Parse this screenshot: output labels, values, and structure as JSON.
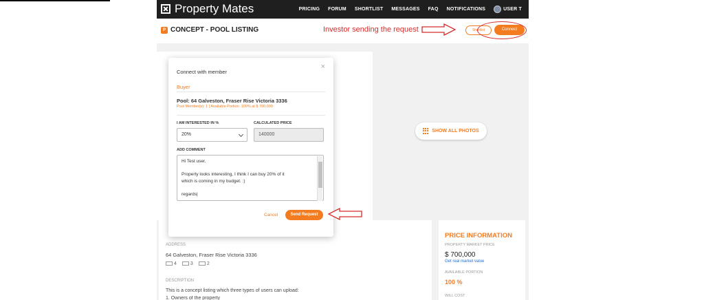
{
  "nav": {
    "brand": "Property Mates",
    "items": [
      "PRICING",
      "FORUM",
      "SHORTLIST",
      "MESSAGES",
      "FAQ",
      "NOTIFICATIONS"
    ],
    "user": "USER T"
  },
  "titlebar": {
    "badge": "P",
    "title": "CONCEPT - POOL LISTING",
    "annotation": "Investor sending the request",
    "shortlist_label": "Shortlist",
    "connect_label": "Connect"
  },
  "photos": {
    "show_all": "SHOW ALL PHOTOS"
  },
  "details": {
    "address_label": "ADDRESS",
    "address": "64 Galveston, Fraser Rise Victoria 3336",
    "beds": "4",
    "baths": "3",
    "cars": "2",
    "description_label": "DESCRIPTION",
    "description": "This is a concept listing which three types of users can upload:",
    "description_next": "1. Owners of the property"
  },
  "price_info": {
    "title": "PRICE INFORMATION",
    "market_price_label": "PROPERTY MARKET PRICE",
    "market_price": "$ 700,000",
    "real_value_link": "Get real market value",
    "available_portion_label": "AVAILABLE PORTION",
    "available_portion": "100 %",
    "will_cost_label": "WILL COST"
  },
  "modal": {
    "title": "Connect with member",
    "close": "×",
    "role": "Buyer",
    "pool": "Pool: 64 Galveston, Fraser Rise Victoria 3336",
    "meta": "Pool Member(s): 1 | Available Portion: 100% at $ 700,000",
    "interest_label": "I AM INTERESTED IN %",
    "interest_value": "20%",
    "calc_label": "CALCULATED PRICE",
    "calc_value": "140000",
    "comment_label": "ADD COMMENT",
    "comment_lines": [
      "Hi Test user,",
      "",
      "Property looks interesting, I think I can buy 20% of it",
      "which is coming in my budget. :)",
      "",
      "regards|"
    ],
    "cancel": "Cancel",
    "send": "Send Request"
  },
  "colors": {
    "accent": "#f47c20",
    "annotation": "#d62b2b",
    "nav_bg": "#1f1f1f"
  }
}
